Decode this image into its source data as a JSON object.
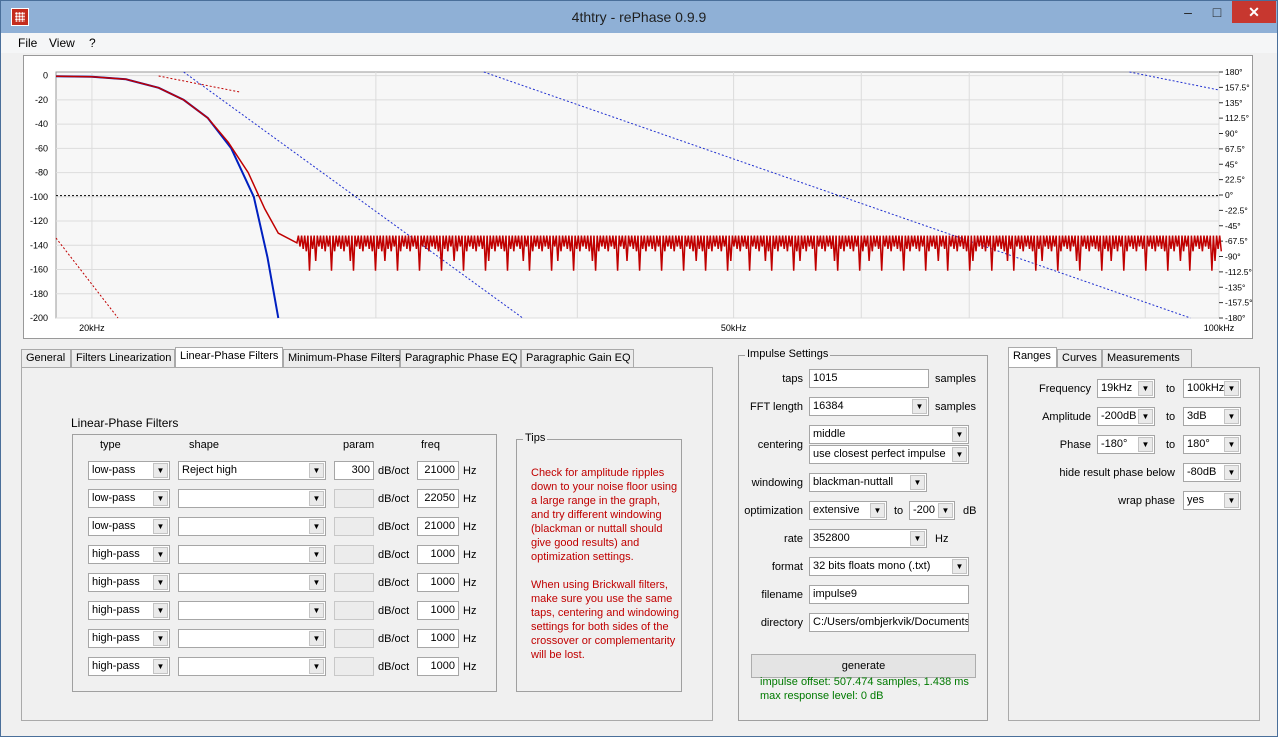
{
  "window": {
    "title": "4thtry  -  rePhase 0.9.9",
    "minimize_glyph": "‒",
    "maximize_glyph": "□",
    "close_glyph": "✕"
  },
  "menu": [
    "File",
    "View",
    "?"
  ],
  "chart_data": {
    "type": "line",
    "title": "",
    "x_tick_labels": [
      "20kHz",
      "50kHz",
      "100kHz"
    ],
    "x_ticks": [
      20000,
      50000,
      100000
    ],
    "xlim": [
      19000,
      100000
    ],
    "x_scale": "log",
    "ylim_left": [
      -200,
      3
    ],
    "y_left_ticks": [
      0,
      -20,
      -40,
      -60,
      -80,
      -100,
      -120,
      -140,
      -160,
      -180,
      -200
    ],
    "y_right_ticks": [
      "180°",
      "157.5°",
      "135°",
      "112.5°",
      "90°",
      "67.5°",
      "45°",
      "22.5°",
      "0°",
      "-22.5°",
      "-45°",
      "-67.5°",
      "-90°",
      "-112.5°",
      "-135°",
      "-157.5°",
      "-180°"
    ],
    "ylim_right": [
      -180,
      180
    ],
    "grid": true,
    "reference_line_db": -99,
    "series": [
      {
        "color": "#0020c0",
        "x": [
          19000,
          20000,
          21000,
          22000,
          22800,
          23600,
          24400,
          25200,
          25700,
          26100
        ],
        "y": [
          -0.5,
          -1,
          -3,
          -10,
          -20,
          -35,
          -60,
          -100,
          -150,
          -200
        ]
      },
      {
        "color": "#c00000",
        "x": [
          19000,
          20000,
          21000,
          22000,
          22800,
          23600,
          24300,
          25000,
          25600,
          26100,
          26800
        ],
        "y": [
          -0.5,
          -1,
          -3,
          -10,
          -20,
          -35,
          -55,
          -80,
          -110,
          -130,
          -138
        ],
        "noise_floor_db": -135,
        "noise_floor_until_hz": 100000
      }
    ]
  },
  "tabs_left": [
    "General",
    "Filters Linearization",
    "Linear-Phase Filters",
    "Minimum-Phase Filters",
    "Paragraphic Phase EQ",
    "Paragraphic Gain EQ"
  ],
  "linear_phase": {
    "group_title": "Linear-Phase Filters",
    "headers": {
      "type": "type",
      "shape": "shape",
      "param": "param",
      "freq": "freq"
    },
    "unit_param": "dB/oct",
    "unit_freq": "Hz",
    "rows": [
      {
        "type": "low-pass",
        "shape": "Reject high",
        "param": "300",
        "freq": "21000"
      },
      {
        "type": "low-pass",
        "shape": "",
        "param": "",
        "freq": "22050"
      },
      {
        "type": "low-pass",
        "shape": "",
        "param": "",
        "freq": "21000"
      },
      {
        "type": "high-pass",
        "shape": "",
        "param": "",
        "freq": "1000"
      },
      {
        "type": "high-pass",
        "shape": "",
        "param": "",
        "freq": "1000"
      },
      {
        "type": "high-pass",
        "shape": "",
        "param": "",
        "freq": "1000"
      },
      {
        "type": "high-pass",
        "shape": "",
        "param": "",
        "freq": "1000"
      },
      {
        "type": "high-pass",
        "shape": "",
        "param": "",
        "freq": "1000"
      }
    ]
  },
  "tips": {
    "title": "Tips",
    "text": "Check for amplitude ripples down to your noise floor using a large range in the graph, and try different windowing (blackman or nuttall should give good results) and optimization settings.\n\nWhen using Brickwall filters, make sure you use the same taps, centering and windowing settings for both sides of the crossover or complementarity will be lost."
  },
  "impulse": {
    "title": "Impulse Settings",
    "taps_label": "taps",
    "taps": "1015",
    "samples_label": "samples",
    "fft_label": "FFT length",
    "fft": "16384",
    "centering_label": "centering",
    "centering": "middle",
    "centering2": "use closest perfect impulse",
    "windowing_label": "windowing",
    "windowing": "blackman-nuttall",
    "optimization_label": "optimization",
    "optimization": "extensive",
    "to_label": "to",
    "opt_db": "-200",
    "db_label": "dB",
    "rate_label": "rate",
    "rate": "352800",
    "hz_label": "Hz",
    "format_label": "format",
    "format": "32 bits floats mono (.txt)",
    "filename_label": "filename",
    "filename": "impulse9",
    "directory_label": "directory",
    "directory": "C:/Users/ombjerkvik/Documents/",
    "generate_label": "generate",
    "offset_text": "impulse offset: 507.474 samples, 1.438 ms",
    "max_text": "max response level: 0 dB"
  },
  "tabs_right": [
    "Ranges",
    "Curves",
    "Measurements"
  ],
  "ranges": {
    "to_label": "to",
    "frequency_label": "Frequency",
    "freq_from": "19kHz",
    "freq_to": "100kHz",
    "amplitude_label": "Amplitude",
    "amp_from": "-200dB",
    "amp_to": "3dB",
    "phase_label": "Phase",
    "phase_from": "-180°",
    "phase_to": "180°",
    "hide_label": "hide result phase below",
    "hide_value": "-80dB",
    "wrap_label": "wrap phase",
    "wrap_value": "yes"
  }
}
